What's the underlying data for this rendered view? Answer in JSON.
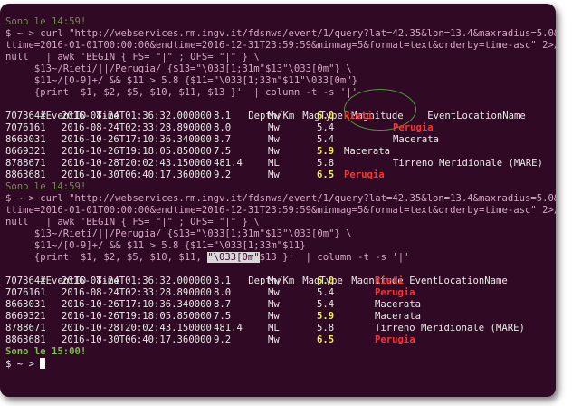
{
  "terminal": {
    "block1": {
      "timestamp": "Sono le 14:59!",
      "cmd": [
        "$ ~ > curl \"http://webservices.rm.ingv.it/fdsnws/event/1/query?lat=42.35&lon=13.4&maxradius=5.0&star",
        "ttime=2016-01-01T00:00:00&endtime=2016-12-31T23:59:59&minmag=5&format=text&orderby=time-asc\" 2>/dev/",
        "null   | awk 'BEGIN { FS= \"|\" ; OFS= \"|\" } \\",
        "     $13~/Rieti/||/Perugia/ {$13=\"\\033[1;31m\"$13\"\\033[0m\"} \\",
        "     $11~/[0-9]+/ && $11 > 5.8 {$11=\"\\033[1;33m\"$11\"\\033[0m\"}",
        "     {print  $1, $2, $5, $10, $11, $13 }'  | column -t -s '|'"
      ],
      "header": [
        "#EventID",
        "Time",
        "Depth/Km",
        "MagType",
        "Magnitude",
        "EventLocationName"
      ],
      "rows": [
        [
          "7073641",
          "2016-08-24T01:36:32.000000",
          "8.1",
          "Mw",
          "6.0",
          "Rieti"
        ],
        [
          "7076161",
          "2016-08-24T02:33:28.890000",
          "8.0",
          "Mw",
          "5.4",
          "Perugia"
        ],
        [
          "8663031",
          "2016-10-26T17:10:36.340000",
          "8.7",
          "Mw",
          "5.4",
          "Macerata"
        ],
        [
          "8669321",
          "2016-10-26T19:18:05.850000",
          "7.5",
          "Mw",
          "5.9",
          "Macerata"
        ],
        [
          "8788671",
          "2016-10-28T20:02:43.150000",
          "481.4",
          "ML",
          "5.8",
          "Tirreno Meridionale (MARE)"
        ],
        [
          "8863681",
          "2016-10-30T06:40:17.360000",
          "9.2",
          "Mw",
          "6.5",
          "Perugia"
        ]
      ]
    },
    "block2": {
      "timestamp": "Sono le 14:59!",
      "cmd": [
        "$ ~ > curl \"http://webservices.rm.ingv.it/fdsnws/event/1/query?lat=42.35&lon=13.4&maxradius=5.0&star",
        "ttime=2016-01-01T00:00:00&endtime=2016-12-31T23:59:59&minmag=5&format=text&orderby=time-asc\" 2>/dev/",
        "null   | awk 'BEGIN { FS= \"|\" ; OFS= \"|\" } \\",
        "     $13~/Rieti/||/Perugia/ {$13=\"\\033[1;31m\"$13\"\\033[0m\"} \\",
        "     $11~/[0-9]+/ && $11 > 5.8 {$11=\"\\033[1;33m\"$11}"
      ],
      "cmd_last_pre": "     {print  $1, $2, $5, $10, $11, ",
      "cmd_last_hl": "\"\\033[0m\"",
      "cmd_last_post": "$13 }'  | column -t -s '|'",
      "header": [
        "#EventID",
        "Time",
        "Depth/Km",
        "MagType",
        "Magnitude",
        "EventLocationName"
      ],
      "rows": [
        [
          "7073641",
          "2016-08-24T01:36:32.000000",
          "8.1",
          "Mw",
          "6.0",
          "Rieti"
        ],
        [
          "7076161",
          "2016-08-24T02:33:28.890000",
          "8.0",
          "Mw",
          "5.4",
          "Perugia"
        ],
        [
          "8663031",
          "2016-10-26T17:10:36.340000",
          "8.7",
          "Mw",
          "5.4",
          "Macerata"
        ],
        [
          "8669321",
          "2016-10-26T19:18:05.850000",
          "7.5",
          "Mw",
          "5.9",
          "Macerata"
        ],
        [
          "8788671",
          "2016-10-28T20:02:43.150000",
          "481.4",
          "ML",
          "5.8",
          "Tirreno Meridionale (MARE)"
        ],
        [
          "8863681",
          "2016-10-30T06:40:17.360000",
          "9.2",
          "Mw",
          "6.5",
          "Perugia"
        ]
      ]
    },
    "final_timestamp": "Sono le 15:00!",
    "prompt": "$ ~ > "
  },
  "colors": {
    "background": "#300a24",
    "magnitude_highlight": "#ffc000",
    "location_highlight": "#ff3030",
    "annotation_circle": "#4f9a3a"
  }
}
